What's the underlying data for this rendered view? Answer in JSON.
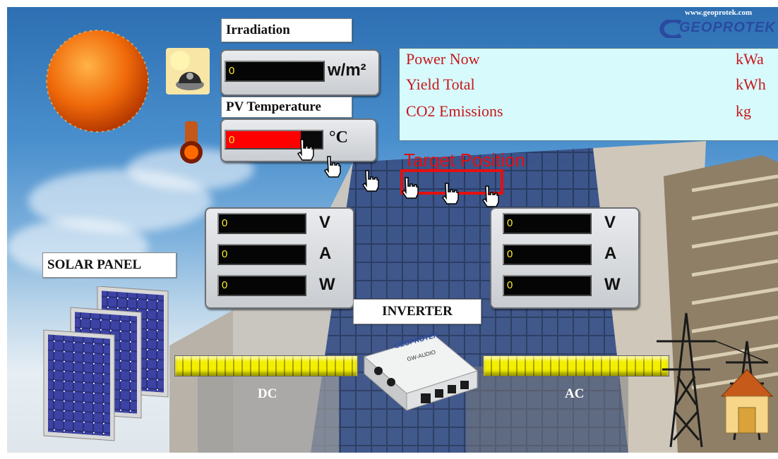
{
  "logo": {
    "url_text": "www.geoprotek.com",
    "wordmark": "GEOPROTEK"
  },
  "irradiation": {
    "title": "Irradiation",
    "value": "0",
    "unit": "w/m²"
  },
  "pv_temperature": {
    "title": "PV Temperature",
    "value": "0",
    "unit": "°C"
  },
  "info": {
    "rows": [
      {
        "label": "Power Now",
        "unit": "kWa"
      },
      {
        "label": "Yield Total",
        "unit": "kWh"
      },
      {
        "label": "CO2 Emissions",
        "unit": "kg"
      }
    ]
  },
  "target": {
    "label": "Target Position"
  },
  "dc_meter": {
    "voltage": "0",
    "current": "0",
    "power": "0",
    "units": [
      "V",
      "A",
      "W"
    ]
  },
  "ac_meter": {
    "voltage": "0",
    "current": "0",
    "power": "0",
    "units": [
      "V",
      "A",
      "W"
    ]
  },
  "labels": {
    "solar_panel": "SOLAR PANEL",
    "inverter": "INVERTER",
    "dc": "DC",
    "ac": "AC"
  },
  "inverter_device": {
    "brand": "GEOPROTEK",
    "model": "GW-AUDIO"
  },
  "colors": {
    "info_text": "#c8161a",
    "info_bg": "#d7fbfd",
    "lcd_text": "#ffef2a",
    "target_red": "#e41010",
    "temp_fill": "#ff0000",
    "bar_yellow": "#f4ef00"
  }
}
